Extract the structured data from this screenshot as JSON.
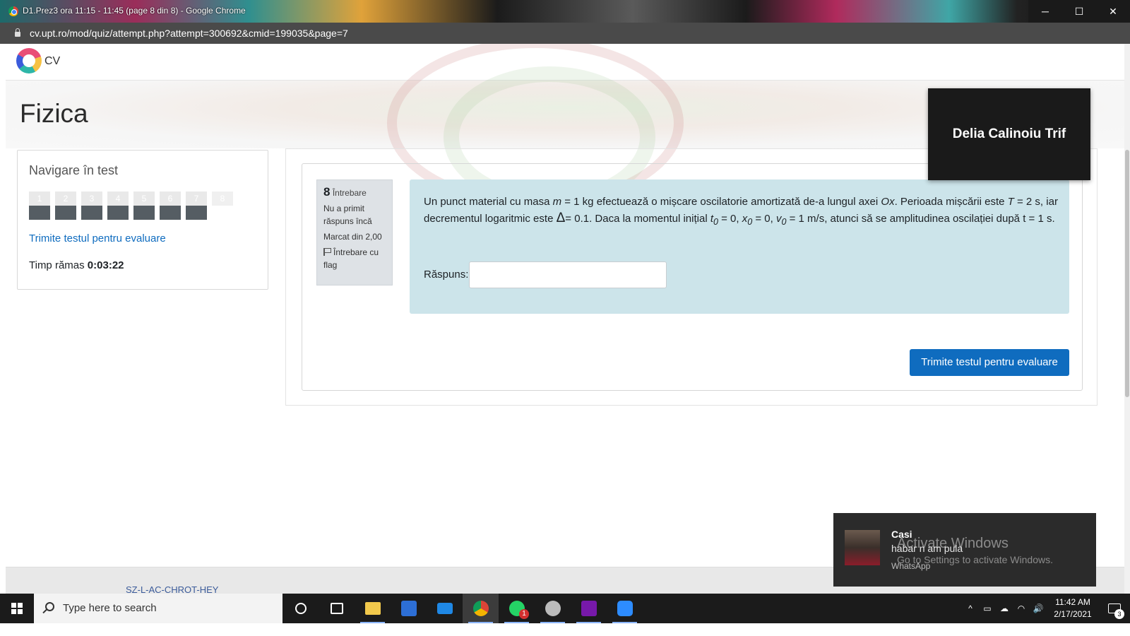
{
  "window": {
    "title": "D1.Prez3 ora 11:15 - 11:45 (page 8 din 8) - Google Chrome",
    "controls": {
      "minimize": "─",
      "maximize": "☐",
      "close": "✕"
    }
  },
  "address_bar": {
    "url": "cv.upt.ro/mod/quiz/attempt.php?attempt=300692&cmid=199035&page=7"
  },
  "site": {
    "logo_text": "CV"
  },
  "course": {
    "title": "Fizica"
  },
  "quiz_nav": {
    "title": "Navigare în test",
    "buttons": [
      {
        "label": "1",
        "state": "answered"
      },
      {
        "label": "2",
        "state": "answered"
      },
      {
        "label": "3",
        "state": "answered"
      },
      {
        "label": "4",
        "state": "answered"
      },
      {
        "label": "5",
        "state": "answered"
      },
      {
        "label": "6",
        "state": "answered"
      },
      {
        "label": "7",
        "state": "answered"
      },
      {
        "label": "8",
        "state": "current"
      }
    ],
    "submit_link": "Trimite testul pentru evaluare",
    "time_label": "Timp rămas",
    "time_value": "0:03:22"
  },
  "question": {
    "number": "8",
    "number_label": "Întrebare",
    "status": "Nu a primit răspuns încă",
    "marks": "Marcat din 2,00",
    "flag_label": "Întrebare cu flag",
    "text_parts": {
      "p1": "Un punct material cu masa ",
      "m": "m",
      "p2": " = 1 kg efectuează o mișcare oscilatorie amortizată de-a lungul axei ",
      "ox": "Ox",
      "p3": ". Perioada mișcării este ",
      "T": "T",
      "p4": " = 2 s, iar decrementul logaritmic este ",
      "delta": "Δ",
      "p5": "= 0.1. Daca la momentul inițial ",
      "t": "t",
      "sub0a": "0",
      "p6": " = 0, ",
      "x": "x",
      "sub0b": "0",
      "p7": " = 0, ",
      "v": "v",
      "sub0c": "0",
      "p8": " = 1 m/s, atunci să se amplitudinea oscilației după t = 1 s."
    },
    "answer_label": "Răspuns:",
    "answer_value": ""
  },
  "submit_button": "Trimite testul pentru evaluare",
  "video_tile": {
    "name": "Delia Calinoiu Trif"
  },
  "footer": {
    "cut_text": "SZ-L-AC-CHROT-HEY"
  },
  "toast": {
    "sender": "Casi",
    "message": "habar n am pula",
    "app": "WhatsApp",
    "watermark_title": "Activate Windows",
    "watermark_sub": "Go to Settings to activate Windows."
  },
  "taskbar": {
    "search_placeholder": "Type here to search",
    "whatsapp_badge": "1",
    "tray_icons": [
      "^",
      "▭",
      "☁",
      "◠",
      "🔊"
    ],
    "time": "11:42 AM",
    "date": "2/17/2021",
    "notification_count": "3"
  },
  "colors": {
    "accent": "#0f6cbf",
    "question_bg": "#cce4ea",
    "nav_answered": "#555d63"
  }
}
